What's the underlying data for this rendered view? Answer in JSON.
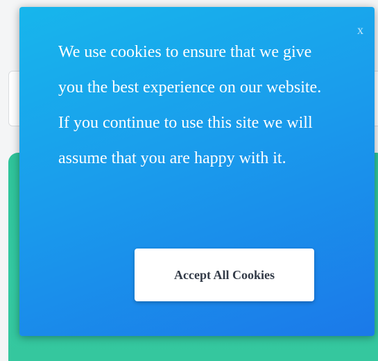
{
  "popup": {
    "message": "We use cookies to ensure that we give you the best experience on our website. If you continue to use this site we will assume that you are happy with it.",
    "close_label": "x",
    "accept_label": "Accept All Cookies"
  },
  "colors": {
    "popup_gradient_start": "#17b6ec",
    "popup_gradient_end": "#1b79e9",
    "background_panel": "#33c9a2",
    "button_text": "#333b48"
  },
  "icons": {
    "close": "close-icon"
  }
}
